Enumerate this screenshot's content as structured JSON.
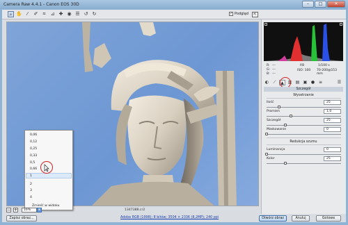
{
  "window": {
    "title": "Camera Raw 4.4.1  -  Canon EOS 30D"
  },
  "toolbar": {
    "preview_label": "Podgląd",
    "tools": [
      "zoom-icon",
      "hand-icon",
      "eyedropper-icon",
      "color-sampler-icon",
      "crop-icon",
      "straighten-icon",
      "retouch-icon",
      "red-eye-icon",
      "preferences-icon",
      "rotate-left-icon",
      "rotate-right-icon"
    ]
  },
  "zoom_menu": {
    "items": [
      "0,06",
      "0,12",
      "0,25",
      "0,33",
      "0,5",
      "0,66",
      "1",
      "2",
      "3",
      "4",
      "Zmieść w widoku"
    ],
    "selected": "1"
  },
  "status": {
    "zoom_value": "16%",
    "filename": "1347388.cr2"
  },
  "camera_info": {
    "r_label": "R:",
    "g_label": "G:",
    "b_label": "B:",
    "r_value": "---",
    "g_value": "---",
    "b_value": "---",
    "aperture": "f/8",
    "shutter": "1/100 s",
    "iso": "ISO: 100",
    "lens": "70-200@153 mm"
  },
  "panel": {
    "section_title": "Szczegół",
    "sharpen_title": "Wyostrzanie",
    "noise_title": "Redukcja szumu",
    "sliders": [
      {
        "label": "Ilość",
        "value": "25",
        "level": 0.17
      },
      {
        "label": "Promień",
        "value": "1,0",
        "level": 0.33
      },
      {
        "label": "Szczegół",
        "value": "25",
        "level": 0.25
      },
      {
        "label": "Maskowanie",
        "value": "0",
        "level": 0.0
      }
    ],
    "noise_sliders": [
      {
        "label": "Luminancja",
        "value": "0",
        "level": 0.0
      },
      {
        "label": "Kolor",
        "value": "25",
        "level": 0.25
      }
    ]
  },
  "footer": {
    "save_label": "Zapisz obraz...",
    "workflow_link": "Adobe RGB (1998); 8 bitów; 3504 × 2336 (8,2MP); 240 ppi",
    "open_label": "Otwórz obraz",
    "cancel_label": "Anuluj",
    "done_label": "Gotowe"
  }
}
